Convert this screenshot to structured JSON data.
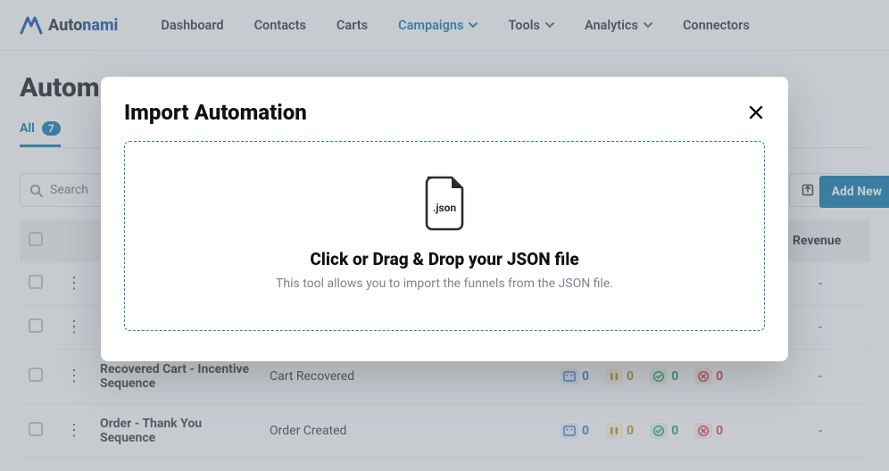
{
  "brand": {
    "name_part1": "Auto",
    "name_part2": "nami"
  },
  "nav": {
    "items": [
      {
        "label": "Dashboard",
        "active": false,
        "dropdown": false
      },
      {
        "label": "Contacts",
        "active": false,
        "dropdown": false
      },
      {
        "label": "Carts",
        "active": false,
        "dropdown": false
      },
      {
        "label": "Campaigns",
        "active": true,
        "dropdown": true
      },
      {
        "label": "Tools",
        "active": false,
        "dropdown": true
      },
      {
        "label": "Analytics",
        "active": false,
        "dropdown": true
      },
      {
        "label": "Connectors",
        "active": false,
        "dropdown": false
      }
    ]
  },
  "page": {
    "title_visible": "Autom",
    "tab_all_label": "All",
    "tab_all_count": "7",
    "add_button": "Add New",
    "search_placeholder": "Search",
    "export_label": "Export"
  },
  "columns": {
    "revenue": "Revenue"
  },
  "rows": [
    {
      "name": "",
      "event": "",
      "stats": null,
      "revenue": "-"
    },
    {
      "name": "",
      "event": "",
      "stats": null,
      "revenue": "-"
    },
    {
      "name": "Recovered Cart - Incentive Sequence",
      "event": "Cart Recovered",
      "stats": {
        "a": "0",
        "b": "0",
        "c": "0",
        "d": "0"
      },
      "revenue": "-"
    },
    {
      "name": "Order - Thank You Sequence",
      "event": "Order Created",
      "stats": {
        "a": "0",
        "b": "0",
        "c": "0",
        "d": "0"
      },
      "revenue": "-"
    }
  ],
  "modal": {
    "title": "Import Automation",
    "file_ext": ".json",
    "dz_title": "Click or Drag & Drop your JSON file",
    "dz_sub": "This tool allows you to import the funnels from the JSON file."
  }
}
